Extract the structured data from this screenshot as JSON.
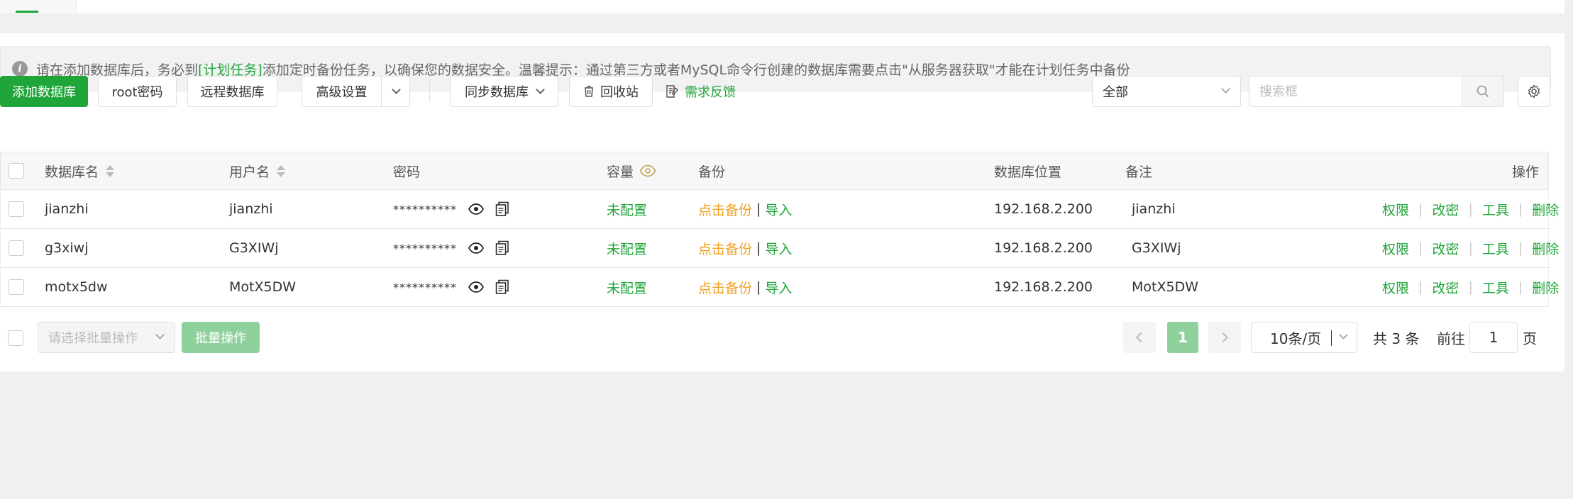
{
  "notice": {
    "text_before": "请在添加数据库后，务必到",
    "link": "[计划任务]",
    "text_after": "添加定时备份任务，以确保您的数据安全。温馨提示：通过第三方或者MySQL命令行创建的数据库需要点击\"从服务器获取\"才能在计划任务中备份"
  },
  "toolbar": {
    "add_db": "添加数据库",
    "root_pwd": "root密码",
    "remote_db": "远程数据库",
    "advanced": "高级设置",
    "sync_db": "同步数据库",
    "recycle": "回收站",
    "feedback": "需求反馈",
    "filter_value": "全部",
    "search_placeholder": "搜索框"
  },
  "table": {
    "headers": {
      "db_name": "数据库名",
      "username": "用户名",
      "password": "密码",
      "capacity": "容量",
      "backup": "备份",
      "location": "数据库位置",
      "remark": "备注",
      "actions": "操作"
    },
    "rows": [
      {
        "db_name": "jianzhi",
        "username": "jianzhi",
        "password": "**********",
        "capacity": "未配置",
        "backup": "点击备份",
        "import": "导入",
        "location": "192.168.2.200",
        "remark": "jianzhi"
      },
      {
        "db_name": "g3xiwj",
        "username": "G3XIWj",
        "password": "**********",
        "capacity": "未配置",
        "backup": "点击备份",
        "import": "导入",
        "location": "192.168.2.200",
        "remark": "G3XIWj"
      },
      {
        "db_name": "motx5dw",
        "username": "MotX5DW",
        "password": "**********",
        "capacity": "未配置",
        "backup": "点击备份",
        "import": "导入",
        "location": "192.168.2.200",
        "remark": "MotX5DW"
      }
    ],
    "actions": {
      "perm": "权限",
      "chpwd": "改密",
      "tools": "工具",
      "delete": "删除"
    }
  },
  "footer": {
    "batch_placeholder": "请选择批量操作",
    "batch_button": "批量操作",
    "current_page": "1",
    "page_size": "10条/页",
    "total": "共 3 条",
    "goto_label": "前往",
    "goto_value": "1",
    "page_suffix": "页"
  },
  "colors": {
    "accent": "#20a53a",
    "accent_light": "#8fd19c",
    "backup_link": "#f0a020"
  }
}
